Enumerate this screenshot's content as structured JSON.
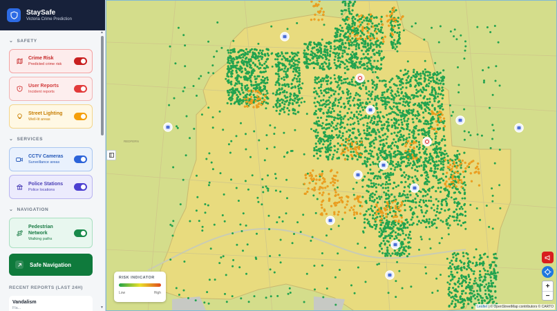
{
  "app": {
    "title": "StaySafe",
    "subtitle": "Victoria Crime Prediction"
  },
  "sections": {
    "safety": "SAFETY",
    "services": "SERVICES",
    "navigation": "NAVIGATION"
  },
  "layers": {
    "crime_risk": {
      "title": "Crime Risk",
      "subtitle": "Predicted crime risk",
      "on": true,
      "color": "#c81e1e"
    },
    "user_reports": {
      "title": "User Reports",
      "subtitle": "Incident reports",
      "on": true,
      "color": "#e23a3a"
    },
    "street_lighting": {
      "title": "Street Lighting",
      "subtitle": "Well-lit areas",
      "on": true,
      "color": "#f59f0a"
    },
    "cctv": {
      "title": "CCTV Cameras",
      "subtitle": "Surveillance areas",
      "on": true,
      "color": "#2b63d9"
    },
    "police": {
      "title": "Police Stations",
      "subtitle": "Police locations",
      "on": true,
      "color": "#4c3fd1"
    },
    "pedestrian": {
      "title": "Pedestrian Network",
      "subtitle": "Walking paths",
      "on": true,
      "color": "#17894a"
    }
  },
  "safe_nav": {
    "label": "Safe Navigation"
  },
  "recent": {
    "heading": "RECENT REPORTS (LAST 24H)",
    "items": [
      {
        "title": "Vandalism",
        "subtitle": "Fla..."
      }
    ]
  },
  "legend": {
    "title": "RISK INDICATOR",
    "low": "Low",
    "high": "High"
  },
  "map": {
    "label_redfern": "REDFERN",
    "attribution_leaflet": "Leaflet",
    "attribution_rest": "| © OpenStreetMap contributors © CARTO",
    "attribution_osm": "OpenStreetMap",
    "attribution_carto": "CARTO"
  },
  "zoom": {
    "in": "+",
    "out": "−"
  }
}
